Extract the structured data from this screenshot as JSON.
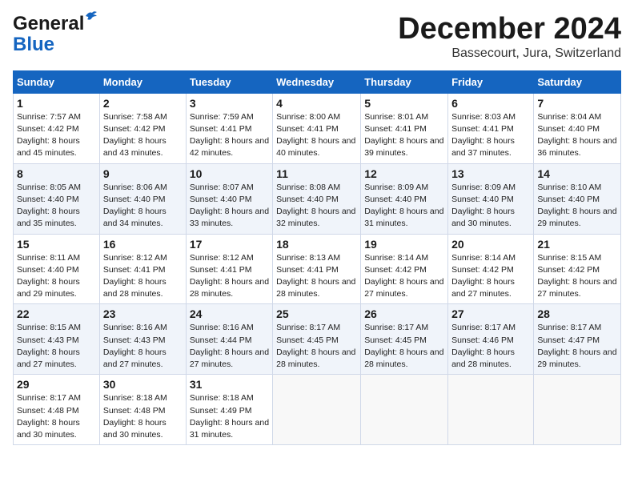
{
  "header": {
    "logo_line1": "General",
    "logo_line2": "Blue",
    "month_title": "December 2024",
    "location": "Bassecourt, Jura, Switzerland"
  },
  "weekdays": [
    "Sunday",
    "Monday",
    "Tuesday",
    "Wednesday",
    "Thursday",
    "Friday",
    "Saturday"
  ],
  "weeks": [
    [
      {
        "day": "1",
        "sunrise": "Sunrise: 7:57 AM",
        "sunset": "Sunset: 4:42 PM",
        "daylight": "Daylight: 8 hours and 45 minutes."
      },
      {
        "day": "2",
        "sunrise": "Sunrise: 7:58 AM",
        "sunset": "Sunset: 4:42 PM",
        "daylight": "Daylight: 8 hours and 43 minutes."
      },
      {
        "day": "3",
        "sunrise": "Sunrise: 7:59 AM",
        "sunset": "Sunset: 4:41 PM",
        "daylight": "Daylight: 8 hours and 42 minutes."
      },
      {
        "day": "4",
        "sunrise": "Sunrise: 8:00 AM",
        "sunset": "Sunset: 4:41 PM",
        "daylight": "Daylight: 8 hours and 40 minutes."
      },
      {
        "day": "5",
        "sunrise": "Sunrise: 8:01 AM",
        "sunset": "Sunset: 4:41 PM",
        "daylight": "Daylight: 8 hours and 39 minutes."
      },
      {
        "day": "6",
        "sunrise": "Sunrise: 8:03 AM",
        "sunset": "Sunset: 4:41 PM",
        "daylight": "Daylight: 8 hours and 37 minutes."
      },
      {
        "day": "7",
        "sunrise": "Sunrise: 8:04 AM",
        "sunset": "Sunset: 4:40 PM",
        "daylight": "Daylight: 8 hours and 36 minutes."
      }
    ],
    [
      {
        "day": "8",
        "sunrise": "Sunrise: 8:05 AM",
        "sunset": "Sunset: 4:40 PM",
        "daylight": "Daylight: 8 hours and 35 minutes."
      },
      {
        "day": "9",
        "sunrise": "Sunrise: 8:06 AM",
        "sunset": "Sunset: 4:40 PM",
        "daylight": "Daylight: 8 hours and 34 minutes."
      },
      {
        "day": "10",
        "sunrise": "Sunrise: 8:07 AM",
        "sunset": "Sunset: 4:40 PM",
        "daylight": "Daylight: 8 hours and 33 minutes."
      },
      {
        "day": "11",
        "sunrise": "Sunrise: 8:08 AM",
        "sunset": "Sunset: 4:40 PM",
        "daylight": "Daylight: 8 hours and 32 minutes."
      },
      {
        "day": "12",
        "sunrise": "Sunrise: 8:09 AM",
        "sunset": "Sunset: 4:40 PM",
        "daylight": "Daylight: 8 hours and 31 minutes."
      },
      {
        "day": "13",
        "sunrise": "Sunrise: 8:09 AM",
        "sunset": "Sunset: 4:40 PM",
        "daylight": "Daylight: 8 hours and 30 minutes."
      },
      {
        "day": "14",
        "sunrise": "Sunrise: 8:10 AM",
        "sunset": "Sunset: 4:40 PM",
        "daylight": "Daylight: 8 hours and 29 minutes."
      }
    ],
    [
      {
        "day": "15",
        "sunrise": "Sunrise: 8:11 AM",
        "sunset": "Sunset: 4:40 PM",
        "daylight": "Daylight: 8 hours and 29 minutes."
      },
      {
        "day": "16",
        "sunrise": "Sunrise: 8:12 AM",
        "sunset": "Sunset: 4:41 PM",
        "daylight": "Daylight: 8 hours and 28 minutes."
      },
      {
        "day": "17",
        "sunrise": "Sunrise: 8:12 AM",
        "sunset": "Sunset: 4:41 PM",
        "daylight": "Daylight: 8 hours and 28 minutes."
      },
      {
        "day": "18",
        "sunrise": "Sunrise: 8:13 AM",
        "sunset": "Sunset: 4:41 PM",
        "daylight": "Daylight: 8 hours and 28 minutes."
      },
      {
        "day": "19",
        "sunrise": "Sunrise: 8:14 AM",
        "sunset": "Sunset: 4:42 PM",
        "daylight": "Daylight: 8 hours and 27 minutes."
      },
      {
        "day": "20",
        "sunrise": "Sunrise: 8:14 AM",
        "sunset": "Sunset: 4:42 PM",
        "daylight": "Daylight: 8 hours and 27 minutes."
      },
      {
        "day": "21",
        "sunrise": "Sunrise: 8:15 AM",
        "sunset": "Sunset: 4:42 PM",
        "daylight": "Daylight: 8 hours and 27 minutes."
      }
    ],
    [
      {
        "day": "22",
        "sunrise": "Sunrise: 8:15 AM",
        "sunset": "Sunset: 4:43 PM",
        "daylight": "Daylight: 8 hours and 27 minutes."
      },
      {
        "day": "23",
        "sunrise": "Sunrise: 8:16 AM",
        "sunset": "Sunset: 4:43 PM",
        "daylight": "Daylight: 8 hours and 27 minutes."
      },
      {
        "day": "24",
        "sunrise": "Sunrise: 8:16 AM",
        "sunset": "Sunset: 4:44 PM",
        "daylight": "Daylight: 8 hours and 27 minutes."
      },
      {
        "day": "25",
        "sunrise": "Sunrise: 8:17 AM",
        "sunset": "Sunset: 4:45 PM",
        "daylight": "Daylight: 8 hours and 28 minutes."
      },
      {
        "day": "26",
        "sunrise": "Sunrise: 8:17 AM",
        "sunset": "Sunset: 4:45 PM",
        "daylight": "Daylight: 8 hours and 28 minutes."
      },
      {
        "day": "27",
        "sunrise": "Sunrise: 8:17 AM",
        "sunset": "Sunset: 4:46 PM",
        "daylight": "Daylight: 8 hours and 28 minutes."
      },
      {
        "day": "28",
        "sunrise": "Sunrise: 8:17 AM",
        "sunset": "Sunset: 4:47 PM",
        "daylight": "Daylight: 8 hours and 29 minutes."
      }
    ],
    [
      {
        "day": "29",
        "sunrise": "Sunrise: 8:17 AM",
        "sunset": "Sunset: 4:48 PM",
        "daylight": "Daylight: 8 hours and 30 minutes."
      },
      {
        "day": "30",
        "sunrise": "Sunrise: 8:18 AM",
        "sunset": "Sunset: 4:48 PM",
        "daylight": "Daylight: 8 hours and 30 minutes."
      },
      {
        "day": "31",
        "sunrise": "Sunrise: 8:18 AM",
        "sunset": "Sunset: 4:49 PM",
        "daylight": "Daylight: 8 hours and 31 minutes."
      },
      null,
      null,
      null,
      null
    ]
  ]
}
